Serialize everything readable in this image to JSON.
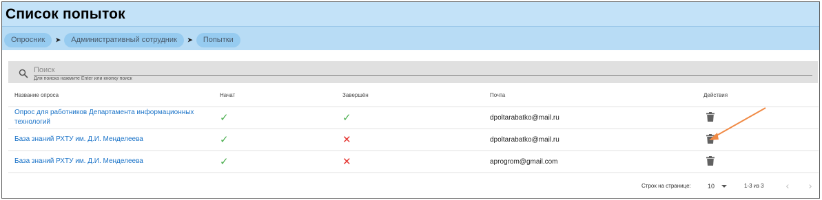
{
  "page": {
    "title": "Список попыток"
  },
  "breadcrumb": {
    "items": [
      {
        "label": "Опросник"
      },
      {
        "label": "Административный сотрудник"
      },
      {
        "label": "Попытки"
      }
    ]
  },
  "search": {
    "placeholder": "Поиск",
    "hint": "Для поиска нажмите Enter или кнопку поиск"
  },
  "table": {
    "headers": {
      "name": "Название опроса",
      "started": "Начат",
      "completed": "Завершён",
      "email": "Почта",
      "actions": "Действия"
    },
    "rows": [
      {
        "name": "Опрос для работников Департамента информационных технологий",
        "started": "check",
        "completed": "check",
        "email": "dpoltarabatko@mail.ru"
      },
      {
        "name": "База знаний РХТУ им. Д.И. Менделеева",
        "started": "check",
        "completed": "cross",
        "email": "dpoltarabatko@mail.ru"
      },
      {
        "name": "База знаний РХТУ им. Д.И. Менделеева",
        "started": "check",
        "completed": "cross",
        "email": "aprogrom@gmail.com"
      }
    ]
  },
  "pagination": {
    "rows_label": "Строк на странице:",
    "rows_value": "10",
    "range": "1-3 из 3"
  },
  "colors": {
    "header_bg": "#b8dcf5",
    "crumb_bg": "#96cbf0",
    "link": "#1a73c8",
    "check": "#4caf50",
    "cross": "#e53935",
    "annotation_arrow": "#f08a45"
  }
}
